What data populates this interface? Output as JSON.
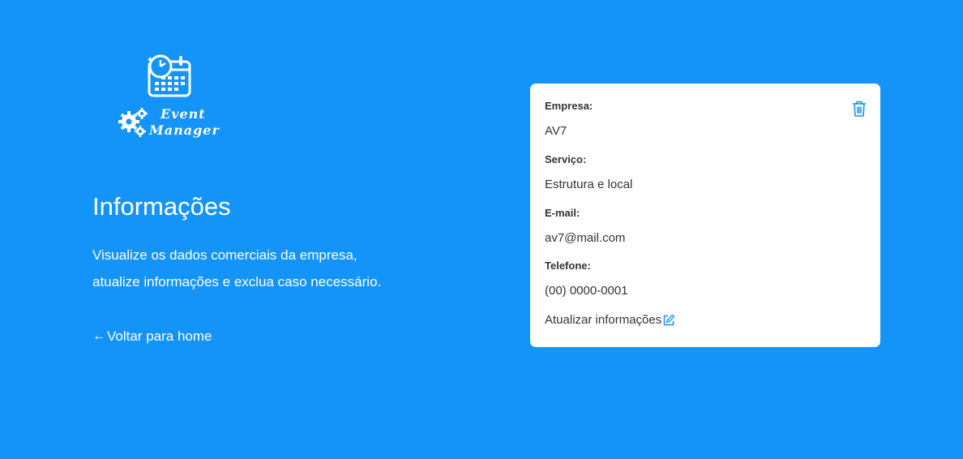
{
  "brand": {
    "line1": "Event",
    "line2": "Manager"
  },
  "intro": {
    "title": "Informações",
    "description": "Visualize os dados comerciais da empresa, atualize informações e exclua caso necessário.",
    "back_arrow": "←",
    "back_label": "Voltar para home"
  },
  "card": {
    "fields": [
      {
        "label": "Empresa:",
        "value": "AV7"
      },
      {
        "label": "Serviço:",
        "value": "Estrutura e local"
      },
      {
        "label": "E-mail:",
        "value": "av7@mail.com"
      },
      {
        "label": "Telefone:",
        "value": "(00) 0000-0001"
      }
    ],
    "update_label": "Atualizar informações"
  },
  "icons": {
    "delete": "trash-icon",
    "edit": "edit-icon",
    "logo_calendar": "calendar-clock-icon",
    "logo_gears": "gears-icon"
  },
  "colors": {
    "background": "#1494f8",
    "card": "#ffffff",
    "accent": "#1494f8",
    "text": "#333333"
  }
}
